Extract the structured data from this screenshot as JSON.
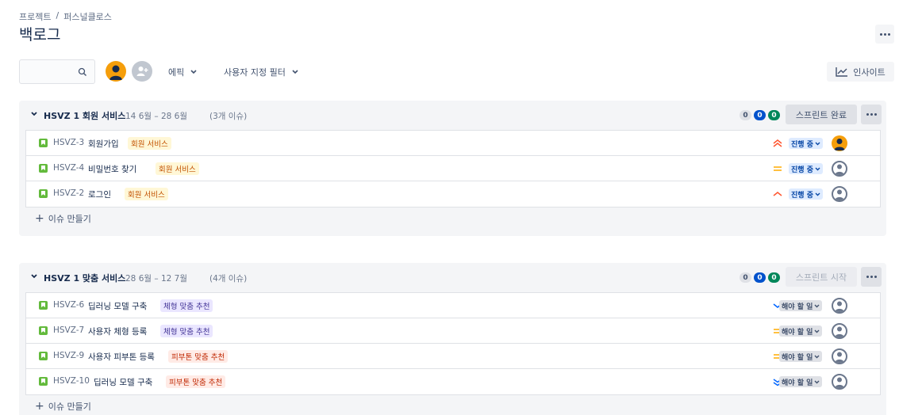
{
  "breadcrumb": {
    "project": "프로젝트",
    "separator": "/",
    "current": "퍼스널클로스"
  },
  "page_title": "백로그",
  "toolbar": {
    "search_placeholder": "",
    "epic_filter": "에픽",
    "custom_filter": "사용자 지정 필터",
    "insights_label": "인사이트"
  },
  "sprints": [
    {
      "name": "HSVZ 1 회원 서비스",
      "dates": "14 6월 – 28 6월",
      "issue_count": "(3개 이슈)",
      "counts": {
        "todo": "0",
        "in_progress": "0",
        "done": "0"
      },
      "action_label": "스프린트 완료",
      "create_label": "이슈 만들기",
      "issues": [
        {
          "key": "HSVZ-3",
          "summary": "회원가입",
          "epic": "회원 서비스",
          "priority": "high",
          "status": "진행 중"
        },
        {
          "key": "HSVZ-4",
          "summary": "비밀번호 찾기",
          "epic": "회원 서비스",
          "priority": "medium",
          "status": "진행 중"
        },
        {
          "key": "HSVZ-2",
          "summary": "로그인",
          "epic": "회원 서비스",
          "priority": "high-single",
          "status": "진행 중"
        }
      ]
    },
    {
      "name": "HSVZ 1 맞춤 서비스",
      "dates": "28 6월 – 12 7월",
      "issue_count": "(4개 이슈)",
      "counts": {
        "todo": "0",
        "in_progress": "0",
        "done": "0"
      },
      "action_label": "스프린트 시작",
      "create_label": "이슈 만들기",
      "issues": [
        {
          "key": "HSVZ-6",
          "summary": "딥러닝 모델 구축",
          "epic": "체형 맞춤 추천",
          "priority": "low",
          "status": "해야 할 일"
        },
        {
          "key": "HSVZ-7",
          "summary": "사용자 체형 등록",
          "epic": "체형 맞춤 추천",
          "priority": "medium",
          "status": "해야 할 일"
        },
        {
          "key": "HSVZ-9",
          "summary": "사용자 피부톤 등록",
          "epic": "피부톤 맞춤 추천",
          "priority": "medium",
          "status": "해야 할 일"
        },
        {
          "key": "HSVZ-10",
          "summary": "딥러닝 모델 구축",
          "epic": "피부톤 맞춤 추천",
          "priority": "lowest",
          "status": "해야 할 일"
        }
      ]
    }
  ],
  "colors": {
    "accent": "#0052cc",
    "story": "#63ba3c",
    "done": "#00875a",
    "priority_high": "#ff5630",
    "priority_medium": "#ffab00",
    "priority_low": "#0065ff"
  }
}
